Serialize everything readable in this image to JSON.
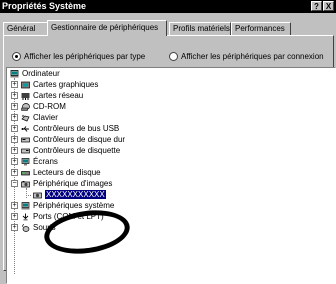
{
  "window": {
    "title": "Propriétés Système",
    "help_btn": "?",
    "close_btn": "X"
  },
  "tabs": [
    {
      "label": "Général"
    },
    {
      "label": "Gestionnaire de périphériques"
    },
    {
      "label": "Profils matériels"
    },
    {
      "label": "Performances"
    }
  ],
  "view_options": {
    "by_type": "Afficher les périphériques par type",
    "by_connection": "Afficher les périphériques par connexion",
    "selected": "by_type"
  },
  "tree": {
    "root": "Ordinateur",
    "items": [
      {
        "label": "Cartes graphiques",
        "icon": "display-adapter-icon",
        "expanded": false
      },
      {
        "label": "Cartes réseau",
        "icon": "network-adapter-icon",
        "expanded": false
      },
      {
        "label": "CD-ROM",
        "icon": "cdrom-icon",
        "expanded": false
      },
      {
        "label": "Clavier",
        "icon": "keyboard-icon",
        "expanded": false
      },
      {
        "label": "Contrôleurs de bus USB",
        "icon": "usb-icon",
        "expanded": false
      },
      {
        "label": "Contrôleurs de disque dur",
        "icon": "hdd-controller-icon",
        "expanded": false
      },
      {
        "label": "Contrôleurs de disquette",
        "icon": "floppy-controller-icon",
        "expanded": false
      },
      {
        "label": "Écrans",
        "icon": "monitor-icon",
        "expanded": false
      },
      {
        "label": "Lecteurs de disque",
        "icon": "disk-drive-icon",
        "expanded": false
      },
      {
        "label": "Périphérique d'images",
        "icon": "imaging-device-icon",
        "expanded": true
      },
      {
        "label": "XXXXXXXXXXX",
        "icon": "camera-icon",
        "child": true,
        "selected": true
      },
      {
        "label": "Périphériques système",
        "icon": "system-device-icon",
        "expanded": false
      },
      {
        "label": "Ports (COM et LPT)",
        "icon": "port-icon",
        "expanded": false
      },
      {
        "label": "Souris",
        "icon": "mouse-icon",
        "expanded": false
      }
    ]
  },
  "colors": {
    "selection": "#000080",
    "annotation": "#000000"
  }
}
